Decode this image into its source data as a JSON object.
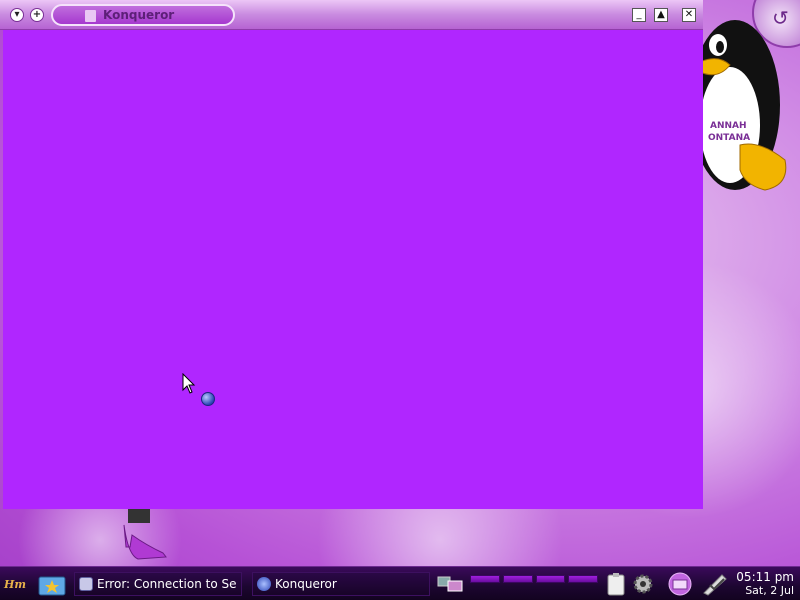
{
  "window": {
    "title": "Konqueror",
    "controls": {
      "menu": "▾",
      "sticky": "+",
      "minimize": "_",
      "maximize": "▲",
      "close": "✕"
    }
  },
  "desktop": {
    "icons": [
      "tux-mascot-icon",
      "high-heel-shoe-icon",
      "corner-orb-icon"
    ]
  },
  "taskbar": {
    "tasks": [
      {
        "label": "Error: Connection to Se",
        "icon": "shield-icon"
      },
      {
        "label": "Konqueror",
        "icon": "konqueror-globe-icon"
      }
    ],
    "clock": {
      "time": "05:11 pm",
      "date": "Sat, 2 Jul"
    }
  },
  "colors": {
    "content_background": "#b026ff",
    "accent": "#a639cf"
  }
}
